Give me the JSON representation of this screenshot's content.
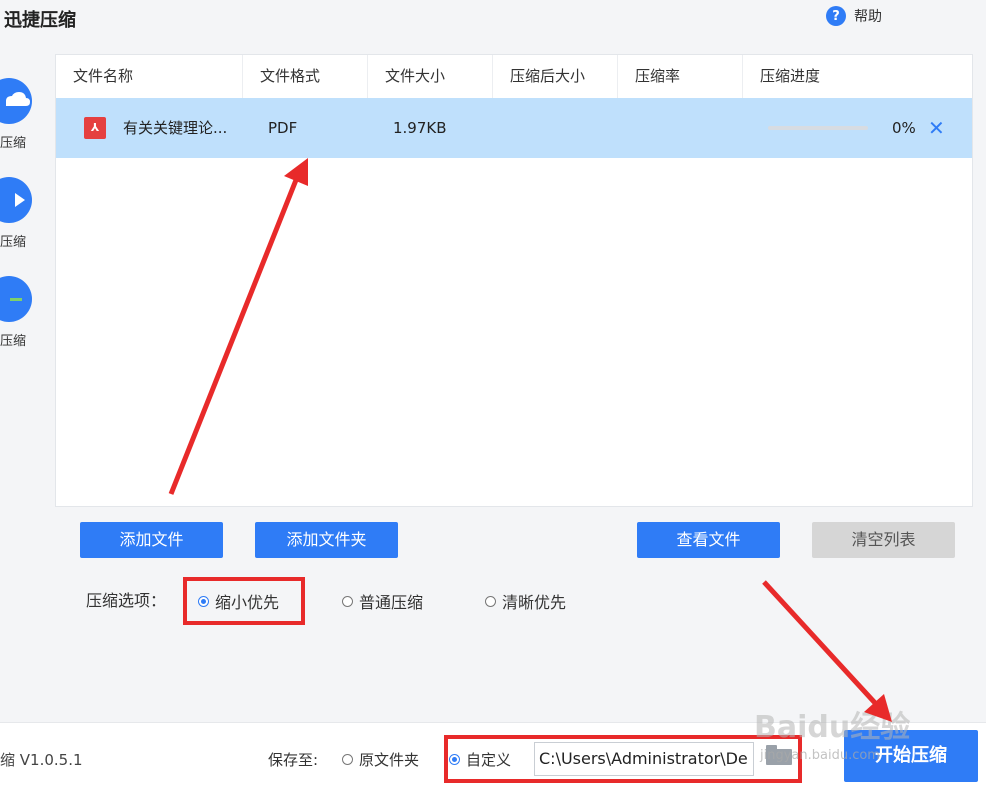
{
  "app": {
    "title": "迅捷压缩"
  },
  "help": {
    "icon": "?",
    "label": "帮助"
  },
  "sidebar": {
    "items": [
      {
        "label": "压缩",
        "icon": "cloud-icon"
      },
      {
        "label": "压缩",
        "icon": "play-icon"
      },
      {
        "label": "压缩",
        "icon": "chart-icon"
      }
    ]
  },
  "table": {
    "headers": [
      "文件名称",
      "文件格式",
      "文件大小",
      "压缩后大小",
      "压缩率",
      "压缩进度"
    ],
    "rows": [
      {
        "icon": "pdf-file-icon",
        "name": "有关关键理论...",
        "format": "PDF",
        "size": "1.97KB",
        "compressed_size": "",
        "rate": "",
        "progress": 0,
        "progress_text": "0%",
        "remove": "✕"
      }
    ]
  },
  "buttons": {
    "add_file": "添加文件",
    "add_folder": "添加文件夹",
    "view_files": "查看文件",
    "clear_list": "清空列表",
    "start": "开始压缩"
  },
  "options": {
    "label": "压缩选项：",
    "choices": [
      "缩小优先",
      "普通压缩",
      "清晰优先"
    ],
    "selected": "缩小优先"
  },
  "footer": {
    "version": "缩 V1.0.5.1",
    "save_label": "保存至:",
    "save_options": [
      "原文件夹",
      "自定义"
    ],
    "save_selected": "自定义",
    "path_value": "C:\\Users\\Administrator\\De"
  },
  "watermark": {
    "text": "Baidu经验",
    "sub": "jingyan.baidu.com"
  },
  "colors": {
    "accent": "#2f7cf6",
    "highlight": "#e82a2a",
    "row_selected": "#bfe0fc"
  }
}
